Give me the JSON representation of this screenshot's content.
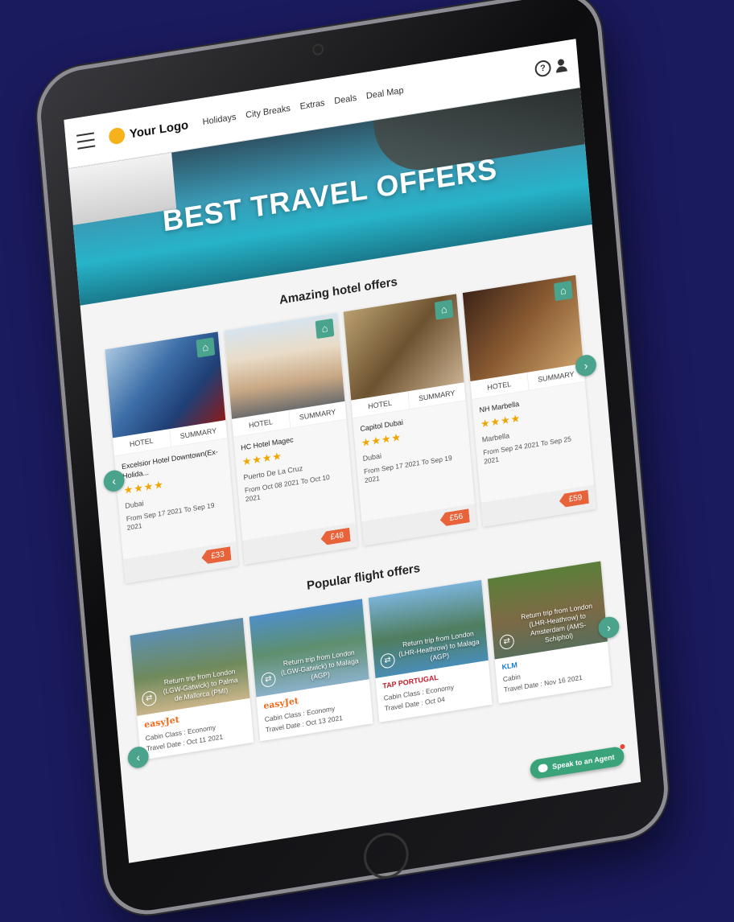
{
  "nav": {
    "logo": "Your Logo",
    "links": [
      "Holidays",
      "City Breaks",
      "Extras",
      "Deals",
      "Deal Map"
    ],
    "help_glyph": "?"
  },
  "hero": {
    "title": "BEST TRAVEL OFFERS"
  },
  "hotels": {
    "title": "Amazing hotel offers",
    "tab_hotel": "HOTEL",
    "tab_summary": "SUMMARY",
    "items": [
      {
        "name": "Excelsior Hotel Downtown(Ex-Holida...",
        "stars": "★★★★",
        "location": "Dubai",
        "dates": "From Sep 17 2021 To Sep 19 2021",
        "price": "£33"
      },
      {
        "name": "HC Hotel Magec",
        "stars": "★★★★",
        "location": "Puerto De La Cruz",
        "dates": "From Oct 08 2021 To Oct 10 2021",
        "price": "£48"
      },
      {
        "name": "Capitol Dubai",
        "stars": "★★★★",
        "location": "Dubai",
        "dates": "From Sep 17 2021 To Sep 19 2021",
        "price": "£56"
      },
      {
        "name": "NH Marbella",
        "stars": "★★★★",
        "location": "Marbella",
        "dates": "From Sep 24 2021 To Sep 25 2021",
        "price": "£59"
      }
    ]
  },
  "flights": {
    "title": "Popular flight offers",
    "items": [
      {
        "route": "Return trip from London (LGW-Gatwick) to Palma de Mallorca (PMI)",
        "airline": "easyJet",
        "cabin": "Cabin Class : Economy",
        "date": "Travel Date : Oct 11 2021"
      },
      {
        "route": "Return trip from London (LGW-Gatwick) to Malaga (AGP)",
        "airline": "easyJet",
        "cabin": "Cabin Class : Economy",
        "date": "Travel Date : Oct 13 2021"
      },
      {
        "route": "Return trip from London (LHR-Heathrow) to Malaga (AGP)",
        "airline": "TAP PORTUGAL",
        "cabin": "Cabin Class : Economy",
        "date": "Travel Date : Oct 04"
      },
      {
        "route": "Return trip from London (LHR-Heathrow) to Amsterdam (AMS-Schiphol)",
        "airline": "KLM",
        "cabin": "Cabin",
        "date": "Travel Date : Nov 16 2021"
      }
    ]
  },
  "agent_button": "Speak to an Agent",
  "icons": {
    "home": "home-icon",
    "prev": "chevron-left-icon",
    "next": "chevron-right-icon",
    "swap": "swap-icon"
  },
  "colors": {
    "accent": "#4aa38c",
    "price": "#e8623a",
    "star": "#f0a500",
    "agent": "#3aa37a",
    "background": "#1a1a5e"
  }
}
